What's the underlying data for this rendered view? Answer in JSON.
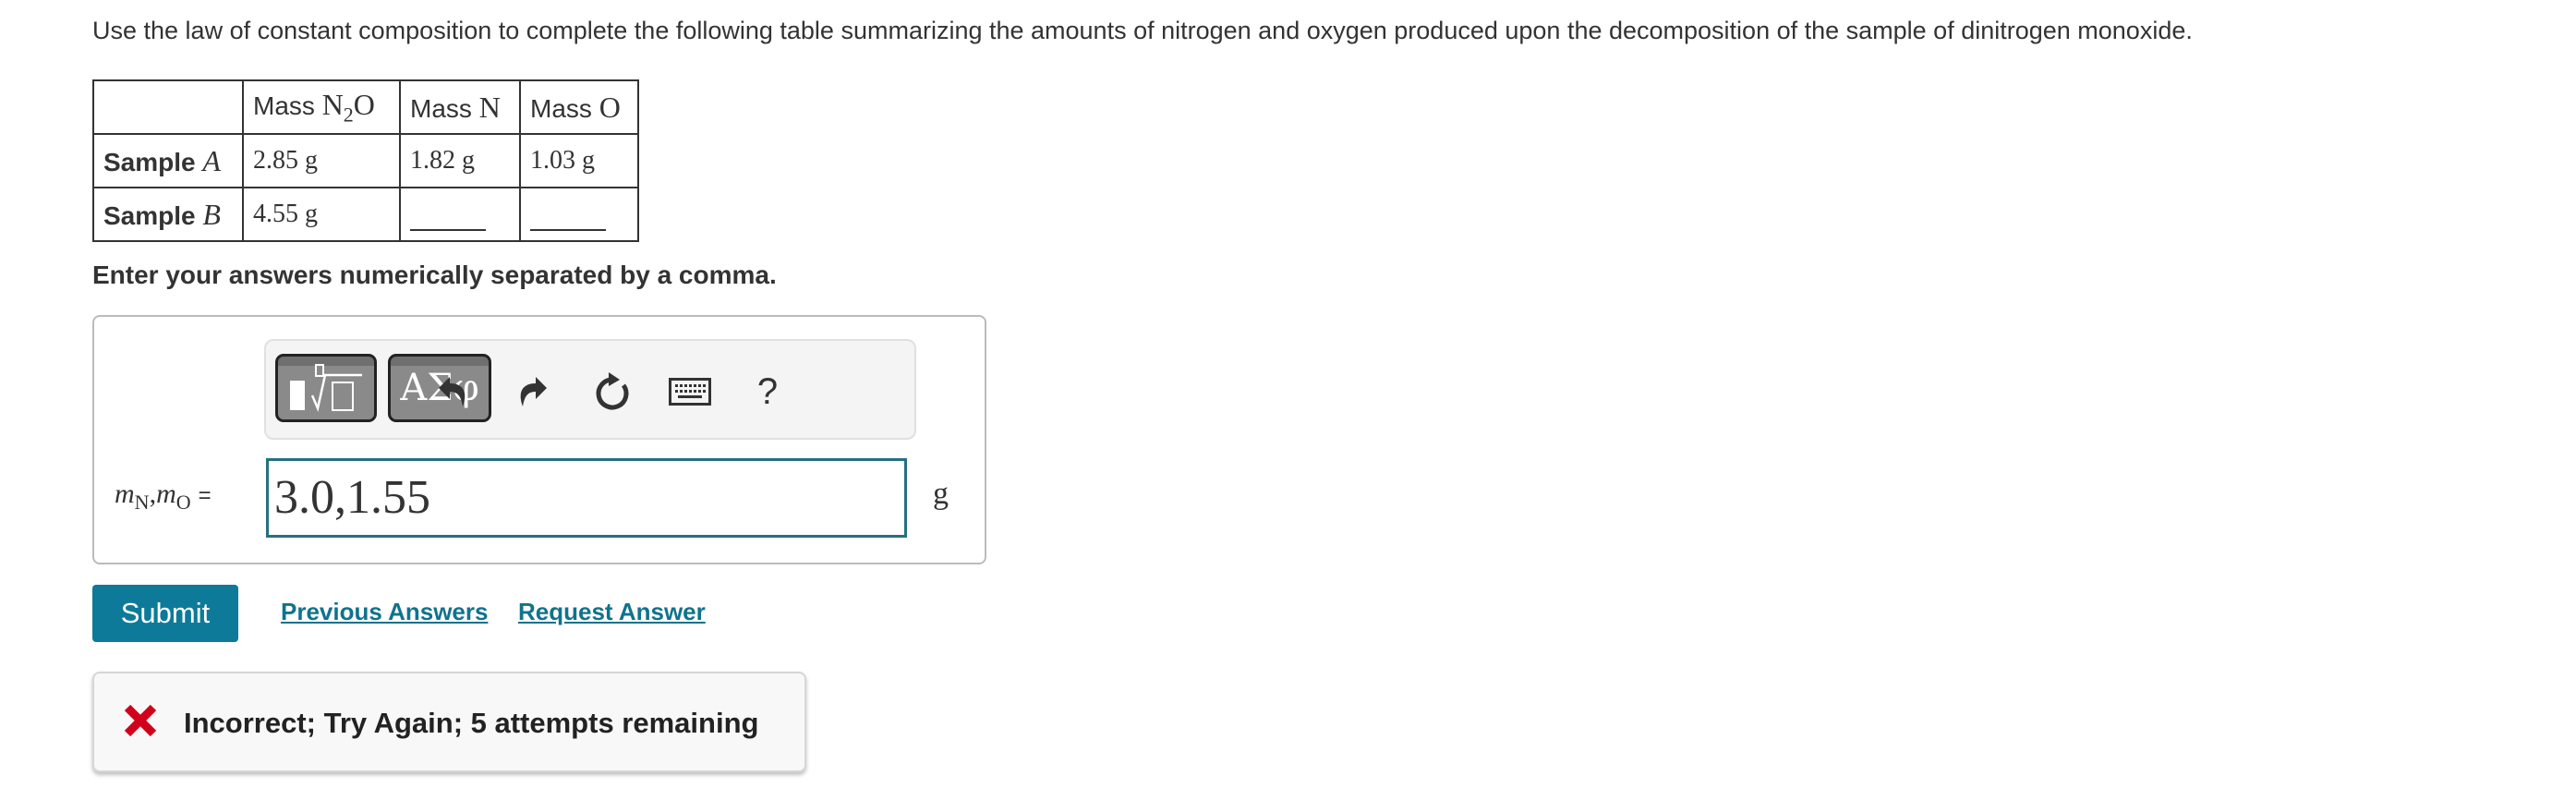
{
  "instruction": "Use the law of constant composition to complete the following table summarizing the amounts of nitrogen and oxygen produced upon the decomposition of the sample of dinitrogen monoxide.",
  "table": {
    "headers": [
      {
        "prefix": "",
        "math": ""
      },
      {
        "prefix": "Mass ",
        "math_main": "N",
        "math_sub": "2",
        "math_tail": "O"
      },
      {
        "prefix": "Mass ",
        "math_main": "N",
        "math_sub": "",
        "math_tail": ""
      },
      {
        "prefix": "Mass ",
        "math_main": "O",
        "math_sub": "",
        "math_tail": ""
      }
    ],
    "rows": [
      {
        "label": "Sample ",
        "label_var": "A",
        "cells": [
          "2.85 g",
          "1.82 g",
          "1.03 g"
        ]
      },
      {
        "label": "Sample ",
        "label_var": "B",
        "cells": [
          "4.55 g",
          "",
          ""
        ]
      }
    ]
  },
  "prompt": "Enter your answers numerically separated by a comma.",
  "toolbar": {
    "buttons": [
      {
        "name": "templates",
        "icon": "templates-icon"
      },
      {
        "name": "symbols",
        "label": "ΑΣφ",
        "icon": "greek-symbols-icon"
      },
      {
        "name": "undo",
        "icon": "undo-icon"
      },
      {
        "name": "redo",
        "icon": "redo-icon"
      },
      {
        "name": "reset",
        "icon": "reset-icon"
      },
      {
        "name": "keyboard",
        "icon": "keyboard-icon"
      },
      {
        "name": "help",
        "label": "?",
        "icon": "help-icon"
      }
    ]
  },
  "answer": {
    "var1": "m",
    "var1_sub": "N",
    "sep": ",",
    "var2": "m",
    "var2_sub": "O",
    "equals": "=",
    "value": "3.0,1.55",
    "unit": "g"
  },
  "actions": {
    "submit": "Submit",
    "previous_answers": "Previous Answers",
    "request_answer": "Request Answer"
  },
  "feedback": {
    "status": "incorrect",
    "message": "Incorrect; Try Again; 5 attempts remaining",
    "color": "#d0021b"
  },
  "colors": {
    "accent": "#0d7a99",
    "link": "#10738c",
    "input_border": "#25707f"
  }
}
